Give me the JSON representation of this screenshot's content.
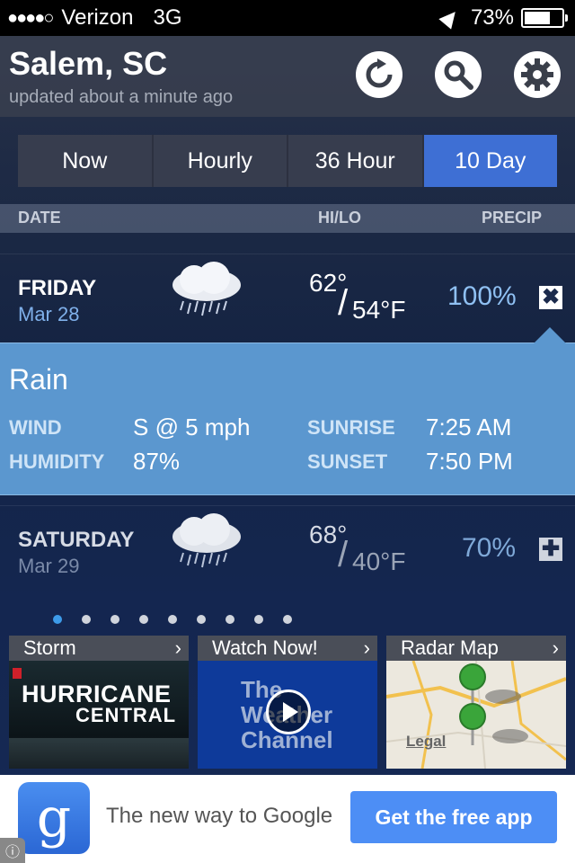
{
  "status": {
    "signal": "●●●●○",
    "carrier": "Verizon",
    "network": "3G",
    "battery": "73%",
    "battery_level": 0.73
  },
  "header": {
    "city": "Salem, SC",
    "updated": "updated about a minute ago",
    "refresh_icon": "refresh-icon",
    "search_icon": "search-icon",
    "settings_icon": "gear-icon"
  },
  "tabs": [
    {
      "label": "Now"
    },
    {
      "label": "Hourly"
    },
    {
      "label": "36 Hour"
    },
    {
      "label": "10 Day",
      "active": true
    }
  ],
  "columns": {
    "date": "DATE",
    "hilo": "HI/LO",
    "precip": "PRECIP"
  },
  "days": [
    {
      "name": "FRIDAY",
      "date": "Mar 28",
      "hi": "62°",
      "lo": "54°F",
      "precip": "100%",
      "icon": "rain-cloud-icon",
      "toggle": "✖"
    },
    {
      "name": "SATURDAY",
      "date": "Mar 29",
      "hi": "68°",
      "lo": "40°F",
      "precip": "70%",
      "icon": "rain-cloud-icon",
      "toggle": "✚"
    }
  ],
  "detail": {
    "condition": "Rain",
    "wind_label": "WIND",
    "wind": "S @ 5 mph",
    "humidity_label": "HUMIDITY",
    "humidity": "87%",
    "sunrise_label": "SUNRISE",
    "sunrise": "7:25 AM",
    "sunset_label": "SUNSET",
    "sunset": "7:50 PM"
  },
  "pager": {
    "count": 9,
    "active": 0
  },
  "tiles": [
    {
      "title": "Storm",
      "image_text_1": "HURRICANE",
      "image_text_2": "CENTRAL"
    },
    {
      "title": "Watch Now!",
      "image_text_1": "The",
      "image_text_2": "Weather",
      "image_text_3": "Channel"
    },
    {
      "title": "Radar Map",
      "image_text_1": "Legal"
    }
  ],
  "ad": {
    "text": "The new way to Google",
    "button": "Get the free app",
    "logo": "g"
  },
  "colors": {
    "accent": "#3e6fd4",
    "detail_bg": "#5b97cf",
    "precip": "#8fc0f2"
  }
}
